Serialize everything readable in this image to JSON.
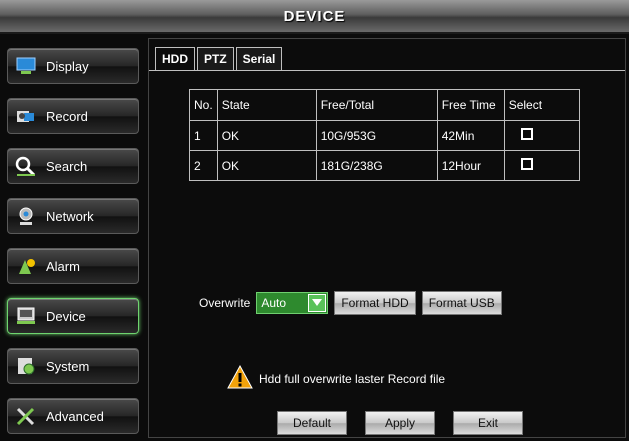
{
  "window": {
    "title": "DEVICE"
  },
  "sidebar": {
    "items": [
      {
        "label": "Display",
        "icon": "monitor-icon"
      },
      {
        "label": "Record",
        "icon": "camera-icon"
      },
      {
        "label": "Search",
        "icon": "search-icon"
      },
      {
        "label": "Network",
        "icon": "network-icon"
      },
      {
        "label": "Alarm",
        "icon": "alarm-icon"
      },
      {
        "label": "Device",
        "icon": "device-icon",
        "active": true
      },
      {
        "label": "System",
        "icon": "system-icon"
      },
      {
        "label": "Advanced",
        "icon": "tools-icon"
      }
    ]
  },
  "tabs": [
    {
      "label": "HDD",
      "active": true
    },
    {
      "label": "PTZ"
    },
    {
      "label": "Serial"
    }
  ],
  "hdd_table": {
    "headers": [
      "No.",
      "State",
      "Free/Total",
      "Free Time",
      "Select"
    ],
    "rows": [
      {
        "no": "1",
        "state": "OK",
        "free_total": "10G/953G",
        "free_time": "42Min",
        "selected": false
      },
      {
        "no": "2",
        "state": "OK",
        "free_total": "181G/238G",
        "free_time": "12Hour",
        "selected": false
      }
    ]
  },
  "overwrite": {
    "label": "Overwrite",
    "value": "Auto"
  },
  "buttons": {
    "format_hdd": "Format HDD",
    "format_usb": "Format USB",
    "default": "Default",
    "apply": "Apply",
    "exit": "Exit"
  },
  "warning": {
    "text": "Hdd full overwrite laster Record file"
  },
  "colors": {
    "accent": "#6fd46f",
    "select_bg": "#2e8a2e",
    "warning": "#f2a20a"
  }
}
